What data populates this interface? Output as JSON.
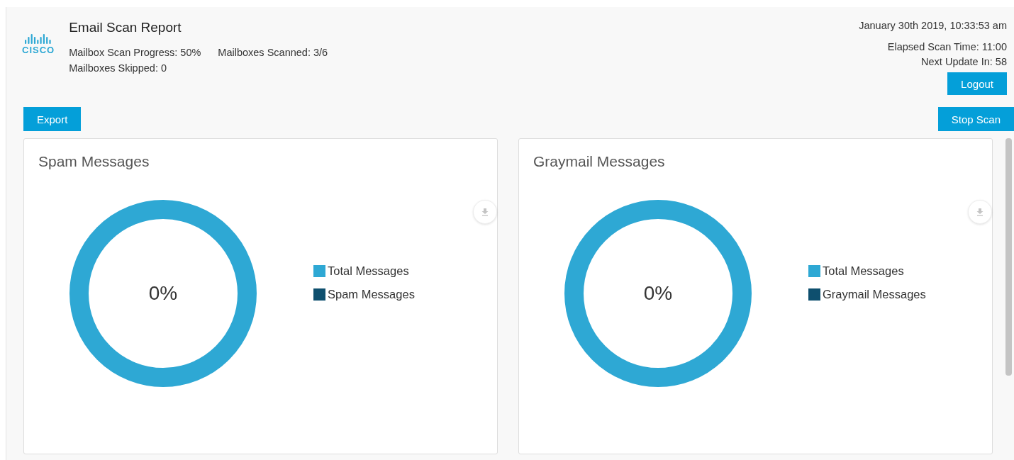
{
  "header": {
    "title": "Email Scan Report",
    "stats": [
      "Mailbox Scan Progress: 50%",
      "Mailboxes Scanned: 3/6",
      "Mailboxes Skipped: 0"
    ],
    "timestamp": "January 30th 2019, 10:33:53 am",
    "elapsed": "Elapsed Scan Time: 11:00",
    "next_update": "Next Update In: 58",
    "logo_text": "CISCO"
  },
  "buttons": {
    "logout": "Logout",
    "export": "Export",
    "stop": "Stop Scan"
  },
  "charts": [
    {
      "title": "Spam Messages",
      "center_label": "0%",
      "legend": [
        {
          "label": "Total Messages",
          "color": "#2ea8d4"
        },
        {
          "label": "Spam Messages",
          "color": "#0e4f6e"
        }
      ]
    },
    {
      "title": "Graymail Messages",
      "center_label": "0%",
      "legend": [
        {
          "label": "Total Messages",
          "color": "#2ea8d4"
        },
        {
          "label": "Graymail Messages",
          "color": "#0e4f6e"
        }
      ]
    }
  ]
}
